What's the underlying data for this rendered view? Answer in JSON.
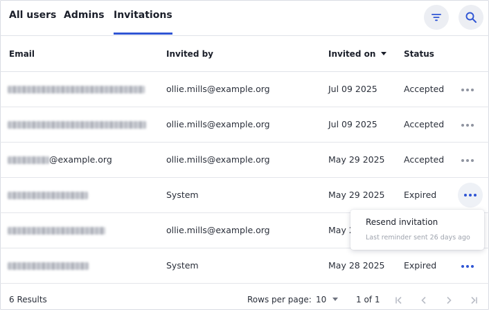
{
  "tabs": [
    {
      "label": "All users"
    },
    {
      "label": "Admins"
    },
    {
      "label": "Invitations",
      "active": true
    }
  ],
  "toolbar": {
    "filter_icon": "filter-icon",
    "search_icon": "search-icon"
  },
  "columns": {
    "email": "Email",
    "invited_by": "Invited by",
    "invited_on": "Invited on",
    "status": "Status"
  },
  "rows": [
    {
      "email_suffix": "",
      "invited_by": "ollie.mills@example.org",
      "invited_on": "Jul 09 2025",
      "status": "Accepted"
    },
    {
      "email_suffix": "",
      "invited_by": "ollie.mills@example.org",
      "invited_on": "Jul 09 2025",
      "status": "Accepted"
    },
    {
      "email_suffix": "@example.org",
      "invited_by": "ollie.mills@example.org",
      "invited_on": "May 29 2025",
      "status": "Accepted"
    },
    {
      "email_suffix": "",
      "invited_by": "System",
      "invited_on": "May 29 2025",
      "status": "Expired"
    },
    {
      "email_suffix": "",
      "invited_by": "ollie.mills@example.org",
      "invited_on": "May 2",
      "status": ""
    },
    {
      "email_suffix": "",
      "invited_by": "System",
      "invited_on": "May 28 2025",
      "status": "Expired"
    }
  ],
  "row_menu": {
    "action": "Resend invitation",
    "note": "Last reminder sent 26 days ago"
  },
  "footer": {
    "results": "6 Results",
    "rows_per_page_label": "Rows per page:",
    "rows_per_page_value": "10",
    "page_info": "1 of 1"
  },
  "colors": {
    "accent": "#2f55d4",
    "icon_bg": "#eceef3"
  }
}
